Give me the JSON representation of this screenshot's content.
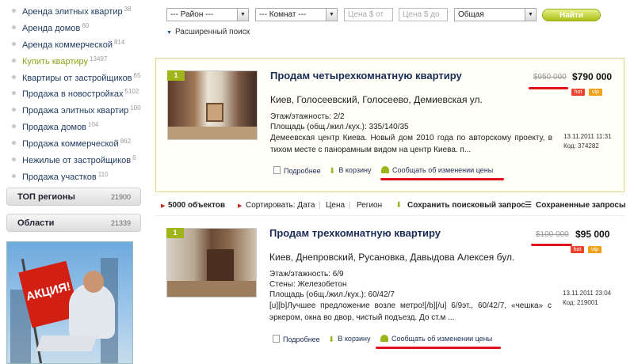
{
  "sidebar": {
    "categories": [
      {
        "label": "Аренда элитных квартир",
        "count": "38"
      },
      {
        "label": "Аренда домов",
        "count": "60"
      },
      {
        "label": "Аренда коммерческой",
        "count": "814"
      },
      {
        "label": "Купить квартиру",
        "count": "13497"
      },
      {
        "label": "Квартиры от застройщиков",
        "count": "65"
      },
      {
        "label": "Продажа в новостройках",
        "count": "5102"
      },
      {
        "label": "Продажа элитных квартир",
        "count": "100"
      },
      {
        "label": "Продажа домов",
        "count": "104"
      },
      {
        "label": "Продажа коммерческой",
        "count": "862"
      },
      {
        "label": "Нежилые от застройщиков",
        "count": "6"
      },
      {
        "label": "Продажа участков",
        "count": "110"
      }
    ],
    "top_regions": {
      "label": "ТОП регионы",
      "count": "21900"
    },
    "regions": {
      "label": "Области",
      "count": "21339"
    },
    "banner": {
      "text": "АКЦИЯ!"
    }
  },
  "search": {
    "district": "--- Район ---",
    "rooms": "--- Комнат ---",
    "price_from": "Цена $ от",
    "price_to": "Цена $ до",
    "area": "Общая",
    "find": "Найти",
    "advanced": "Расширенный поиск"
  },
  "toolbar": {
    "count": "5000 объектов",
    "sort_by": "Сортировать: Дата",
    "price": "Цена",
    "region": "Регион",
    "save_query": "Сохранить поисковый запрос",
    "saved_queries": "Сохраненные запросы"
  },
  "listings": [
    {
      "badge": "1",
      "title": "Продам четырехкомнатную квартиру",
      "old_price": "$950 000",
      "new_price": "$790 000",
      "tag_hot": "hot",
      "tag_vip": "vip",
      "address": "Киев, Голосеевский, Голосеево, Демиевская ул.",
      "floors": "Этаж/этажность: 2/2",
      "area": "Площадь (общ./жил./кух.): 335/140/35",
      "description": "Демеевская центр Киева. Новый дом 2010 года по авторскому проекту, в тихом месте с панорамным видом на центр Киева. п...",
      "date": "13.11.2011 11:31",
      "code": "Код: 374282",
      "action_details": "Подробнее",
      "action_cart": "В корзину",
      "action_notify": "Сообщать об изменении цены"
    },
    {
      "badge": "1",
      "title": "Продам трехкомнатную квартиру",
      "old_price": "$100 000",
      "new_price": "$95 000",
      "tag_hot": "hot",
      "tag_vip": "vip",
      "address": "Киев, Днепровский, Русановка, Давыдова Алексея бул.",
      "floors": "Этаж/этажность: 6/9",
      "walls": "Стены: Железобетон",
      "area": "Площадь (общ./жил./кух.): 60/42/7",
      "description": "[u][b]Лучшее предложение возле метро![/b][/u] 6/9эт., 60/42/7, «чешка» с эркером, окна во двор, чистый подъезд. До ст.м ...",
      "date": "13.11.2011 23:04",
      "code": "Код: 219001",
      "action_details": "Подробнее",
      "action_cart": "В корзину",
      "action_notify": "Сообщать об изменении цены"
    }
  ],
  "colors": {
    "accent_green": "#9fb51a",
    "highlight_red": "#e0111b",
    "title_blue": "#1a2b55"
  }
}
